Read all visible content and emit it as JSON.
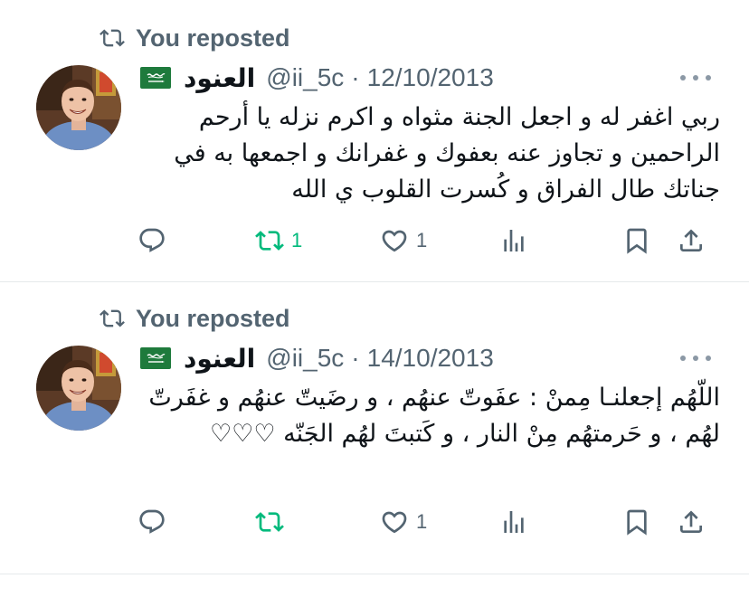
{
  "colors": {
    "text": "#0f1419",
    "muted": "#536471",
    "repost_active": "#00ba7c",
    "divider": "#e6e9eb"
  },
  "tweets": [
    {
      "repost_label": "You reposted",
      "flag": "saudi-flag-emoji",
      "display_name": "العنود",
      "handle": "@ii_5c",
      "separator": "·",
      "date": "12/10/2013",
      "text": "ربي اغفر له و اجعل الجنة مثواه و اكرم نزله يا أرحم الراحمين و تجاوز عنه بعفوك و غفرانك و اجمعها به في جناتك طال الفراق و كُسرت القلوب ي الله",
      "actions": {
        "reply": {
          "icon": "reply-icon"
        },
        "repost": {
          "icon": "repost-icon",
          "count": "1",
          "active": true
        },
        "like": {
          "icon": "heart-icon",
          "count": "1"
        },
        "views": {
          "icon": "views-icon"
        },
        "bookmark": {
          "icon": "bookmark-icon"
        },
        "share": {
          "icon": "share-icon"
        }
      }
    },
    {
      "repost_label": "You reposted",
      "flag": "saudi-flag-emoji",
      "display_name": "العنود",
      "handle": "@ii_5c",
      "separator": "·",
      "date": "14/10/2013",
      "text": "اللّهُم إجعلنـا مِمنْ : عفَوتّ عنهُم ، و رضَيتّ عنهُم   و غفَرتّ لهُم ، و حَرمتهُم  مِنْ النار ، و كَتبتَ لهُم الجَنّه ♡♡♡",
      "actions": {
        "reply": {
          "icon": "reply-icon"
        },
        "repost": {
          "icon": "repost-icon",
          "count": "",
          "active": true
        },
        "like": {
          "icon": "heart-icon",
          "count": "1"
        },
        "views": {
          "icon": "views-icon"
        },
        "bookmark": {
          "icon": "bookmark-icon"
        },
        "share": {
          "icon": "share-icon"
        }
      }
    }
  ]
}
